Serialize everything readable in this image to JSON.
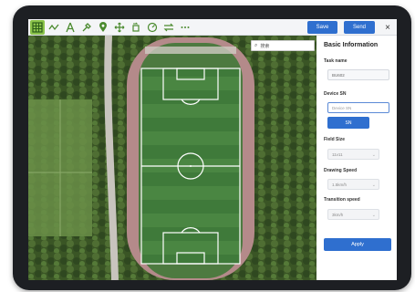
{
  "toolbar": {
    "icons": [
      "grid-icon",
      "polyline-icon",
      "compass-icon",
      "tool-icon",
      "location-pin-icon",
      "move-icon",
      "rotate-icon",
      "speed-icon",
      "swap-icon",
      "more-icon"
    ],
    "save_label": "Save",
    "send_label": "Send",
    "close_label": "×"
  },
  "map": {
    "search_placeholder": "搜索"
  },
  "panel": {
    "title": "Basic Information",
    "task_name_label": "Task name",
    "task_name_value": "BU602",
    "device_sn_label": "Device SN",
    "device_sn_placeholder": "Device SN",
    "sn_button": "SN",
    "field_size_label": "Field Size",
    "field_size_value": "11v11",
    "drawing_speed_label": "Drawing Speed",
    "drawing_speed_value": "1.5km/h",
    "transition_speed_label": "Transition speed",
    "transition_speed_value": "3km/h",
    "apply_label": "Apply"
  },
  "colors": {
    "accent": "#2f6fcf",
    "active_tool": "#8bc34a",
    "track": "#b48a8a",
    "pitch": "#3f7a3a"
  }
}
